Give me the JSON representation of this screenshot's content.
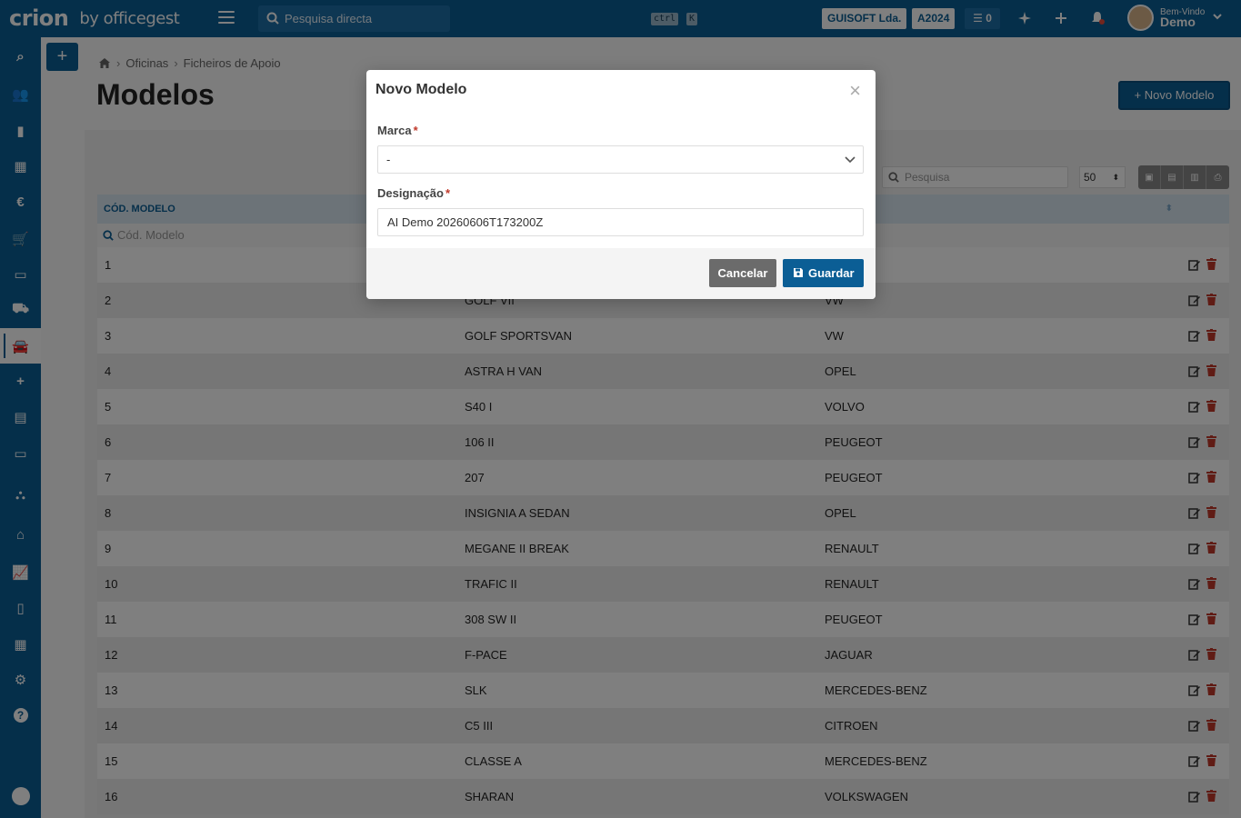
{
  "header": {
    "logo_brand": "crion",
    "logo_by": "by officegest",
    "search_placeholder": "Pesquisa directa",
    "kbd_ctrl": "ctrl",
    "kbd_k": "K",
    "company": "GUISOFT Lda.",
    "year": "A2024",
    "tasks_count": "0",
    "welcome": "Bem-Vindo",
    "user": "Demo"
  },
  "sidebar": {
    "items": [
      {
        "icon": "search-icon"
      },
      {
        "icon": "users-icon"
      },
      {
        "icon": "book-icon"
      },
      {
        "icon": "warehouse-icon"
      },
      {
        "icon": "euro-icon"
      },
      {
        "icon": "cart-icon"
      },
      {
        "icon": "money-icon"
      },
      {
        "icon": "car-repair-icon"
      },
      {
        "icon": "car-icon",
        "active": true
      },
      {
        "icon": "plus-icon"
      },
      {
        "icon": "calculator-icon"
      },
      {
        "icon": "box-icon"
      },
      {
        "icon": "sitemap-icon"
      },
      {
        "icon": "bank-icon"
      },
      {
        "icon": "chart-icon"
      },
      {
        "icon": "file-icon"
      },
      {
        "icon": "table-icon"
      },
      {
        "icon": "settings-icon"
      },
      {
        "icon": "help-icon"
      }
    ]
  },
  "page": {
    "breadcrumb": [
      "Oficinas",
      "Ficheiros de Apoio"
    ],
    "title": "Modelos",
    "new_button": "Novo Modelo",
    "table_search_placeholder": "Pesquisa",
    "page_size": "50"
  },
  "table": {
    "header_code": "CÓD. MODELO",
    "filter_placeholder": "Cód. Modelo",
    "rows": [
      {
        "id": "1",
        "desc": "",
        "brand": ""
      },
      {
        "id": "2",
        "desc": "GOLF VII",
        "brand": "VW"
      },
      {
        "id": "3",
        "desc": "GOLF SPORTSVAN",
        "brand": "VW"
      },
      {
        "id": "4",
        "desc": "ASTRA H VAN",
        "brand": "OPEL"
      },
      {
        "id": "5",
        "desc": "S40 I",
        "brand": "VOLVO"
      },
      {
        "id": "6",
        "desc": "106 II",
        "brand": "PEUGEOT"
      },
      {
        "id": "7",
        "desc": "207",
        "brand": "PEUGEOT"
      },
      {
        "id": "8",
        "desc": "INSIGNIA A SEDAN",
        "brand": "OPEL"
      },
      {
        "id": "9",
        "desc": "MEGANE II BREAK",
        "brand": "RENAULT"
      },
      {
        "id": "10",
        "desc": "TRAFIC II",
        "brand": "RENAULT"
      },
      {
        "id": "11",
        "desc": "308 SW II",
        "brand": "PEUGEOT"
      },
      {
        "id": "12",
        "desc": "F-PACE",
        "brand": "JAGUAR"
      },
      {
        "id": "13",
        "desc": "SLK",
        "brand": "MERCEDES-BENZ"
      },
      {
        "id": "14",
        "desc": "C5 III",
        "brand": "CITROEN"
      },
      {
        "id": "15",
        "desc": "CLASSE A",
        "brand": "MERCEDES-BENZ"
      },
      {
        "id": "16",
        "desc": "SHARAN",
        "brand": "VOLKSWAGEN"
      }
    ]
  },
  "modal": {
    "title": "Novo Modelo",
    "close": "×",
    "marca_label": "Marca",
    "marca_value": "-",
    "designacao_label": "Designação",
    "designacao_value": "AI Demo 20260606T173200Z",
    "required_mark": "*",
    "cancel": "Cancelar",
    "save": "Guardar"
  },
  "colors": {
    "primary": "#0b5e95",
    "danger": "#c0392b"
  }
}
